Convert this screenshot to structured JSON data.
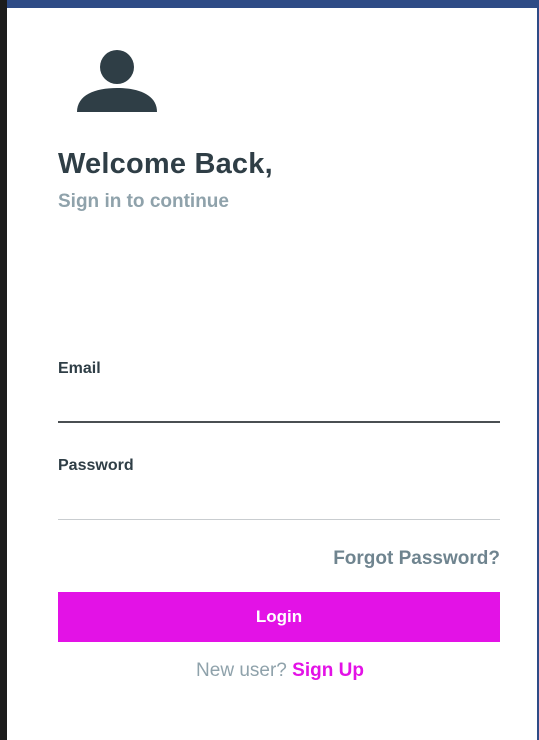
{
  "colors": {
    "accent": "#e312e6",
    "heading": "#2f3e46",
    "muted": "#8fa2ab",
    "link_muted": "#6f848f"
  },
  "header": {
    "icon": "user-icon",
    "title": "Welcome Back,",
    "subtitle": "Sign in to continue"
  },
  "form": {
    "email": {
      "label": "Email",
      "value": "",
      "placeholder": ""
    },
    "password": {
      "label": "Password",
      "value": "",
      "placeholder": ""
    },
    "forgot_label": "Forgot Password?",
    "login_label": "Login"
  },
  "footer": {
    "prompt": "New user?",
    "signup_label": "Sign Up"
  }
}
